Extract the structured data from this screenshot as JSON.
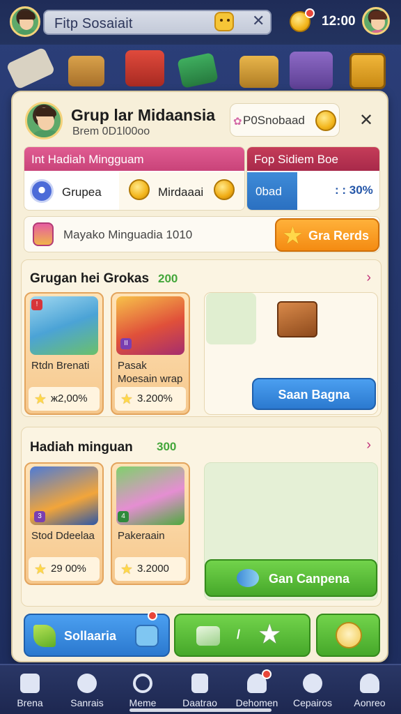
{
  "topbar": {
    "title": "Fitp Sosaiait",
    "coin_count": "12:00"
  },
  "panel": {
    "title": "Grup lar Midaansia",
    "subtitle": "Brem 0D1l00oo",
    "badge_label": "P0Snobaad",
    "tab_left": {
      "header": "Int Hadiah Mingguam",
      "group_label": "Grupea",
      "mingguan_label": "Mirdaaai"
    },
    "tab_right": {
      "header": "Fop Sidiem Boe",
      "stat_label": "0bad",
      "stat_value": ": : 30%"
    },
    "progress_label": "Mayako Minguadia 1010",
    "progress_button": "Gra Rerds"
  },
  "section1": {
    "title": "Grugan hei Grokas",
    "count": "200",
    "items": [
      {
        "name": "Rtdn Brenati",
        "price": "ж2,00%"
      },
      {
        "name": "Pasak Moesain wrap",
        "price": "3.200%"
      }
    ],
    "action_button": "Saan Bagna"
  },
  "section2": {
    "title": "Hadiah minguan",
    "count": "300",
    "items": [
      {
        "name": "Stod Ddeelaa",
        "price": "29 00%"
      },
      {
        "name": "Pakeraain",
        "price": "3.2000"
      }
    ],
    "action_button": "Gan Canpena"
  },
  "bottom_buttons": {
    "left_label": "Sollaaria",
    "middle_label": "/"
  },
  "nav": [
    {
      "label": "Brena",
      "icon": "home-icon"
    },
    {
      "label": "Sanrais",
      "icon": "heart-chat-icon"
    },
    {
      "label": "Meme",
      "icon": "search-icon"
    },
    {
      "label": "Daatrao",
      "icon": "phone-icon"
    },
    {
      "label": "Dehomen",
      "icon": "gift-icon"
    },
    {
      "label": "Cepairos",
      "icon": "gear-icon"
    },
    {
      "label": "Aonreo",
      "icon": "profile-icon"
    }
  ],
  "colors": {
    "accent_pink": "#c94379",
    "accent_blue": "#2b79cf",
    "accent_green": "#46a82a",
    "accent_orange": "#f48b12"
  }
}
